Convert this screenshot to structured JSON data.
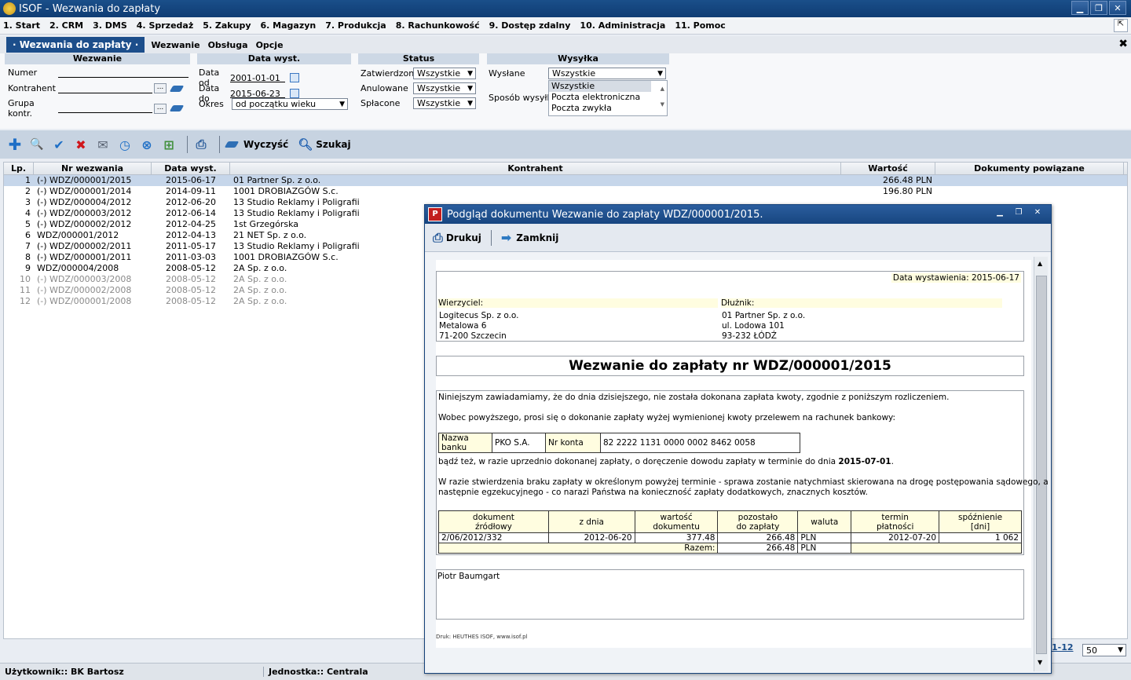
{
  "window": {
    "title": "ISOF - Wezwania do zapłaty",
    "btn_min": "▁",
    "btn_max": "❐",
    "btn_close": "✕"
  },
  "menu": [
    "1. Start",
    "2. CRM",
    "3. DMS",
    "4. Sprzedaż",
    "5. Zakupy",
    "6. Magazyn",
    "7. Produkcja",
    "8. Rachunkowość",
    "9. Dostęp zdalny",
    "10. Administracja",
    "11. Pomoc"
  ],
  "subbar": {
    "active_tab": "· Wezwania do zapłaty ·",
    "items": [
      "Wezwanie",
      "Obsługa",
      "Opcje"
    ]
  },
  "filters": {
    "wezwanie": {
      "header": "Wezwanie",
      "numer": "Numer",
      "kontrahent": "Kontrahent",
      "grupa": "Grupa kontr.",
      "dots": "..."
    },
    "data": {
      "header": "Data wyst.",
      "od_label": "Data od",
      "od_value": "2001-01-01",
      "do_label": "Data do",
      "do_value": "2015-06-23",
      "okres_label": "Okres",
      "okres_value": "od początku wieku"
    },
    "status": {
      "header": "Status",
      "zatw_label": "Zatwierdzone",
      "zatw_value": "Wszystkie",
      "anul_label": "Anulowane",
      "anul_value": "Wszystkie",
      "splac_label": "Spłacone",
      "splac_value": "Wszystkie"
    },
    "wysylka": {
      "header": "Wysyłka",
      "wyslane_label": "Wysłane",
      "wyslane_value": "Wszystkie",
      "sposob_label": "Sposób wysyłki",
      "sposob_options": [
        "Wszystkie",
        "Poczta elektroniczna",
        "Poczta zwykła"
      ]
    }
  },
  "toolbar": {
    "clear": "Wyczyść",
    "search": "Szukaj"
  },
  "grid": {
    "headers": [
      "Lp.",
      "Nr wezwania",
      "Data wyst.",
      "Kontrahent",
      "Wartość",
      "Dokumenty powiązane"
    ],
    "rows": [
      {
        "lp": "1",
        "nr": "(-) WDZ/000001/2015",
        "data": "2015-06-17",
        "kontrahent": "01 Partner Sp. z o.o.",
        "wartosc": "266.48 PLN",
        "dok": ""
      },
      {
        "lp": "2",
        "nr": "(-) WDZ/000001/2014",
        "data": "2014-09-11",
        "kontrahent": "1001 DROBIAZGÓW S.c.",
        "wartosc": "196.80 PLN",
        "dok": ""
      },
      {
        "lp": "3",
        "nr": "(-) WDZ/000004/2012",
        "data": "2012-06-20",
        "kontrahent": "13 Studio Reklamy i Poligrafii",
        "wartosc": "",
        "dok": ""
      },
      {
        "lp": "4",
        "nr": "(-) WDZ/000003/2012",
        "data": "2012-06-14",
        "kontrahent": "13 Studio Reklamy i Poligrafii",
        "wartosc": "",
        "dok": ""
      },
      {
        "lp": "5",
        "nr": "(-) WDZ/000002/2012",
        "data": "2012-04-25",
        "kontrahent": "1st Grzegórska",
        "wartosc": "",
        "dok": ""
      },
      {
        "lp": "6",
        "nr": "WDZ/000001/2012",
        "data": "2012-04-13",
        "kontrahent": "21 NET Sp. z o.o.",
        "wartosc": "",
        "dok": ""
      },
      {
        "lp": "7",
        "nr": "(-) WDZ/000002/2011",
        "data": "2011-05-17",
        "kontrahent": "13 Studio Reklamy i Poligrafii",
        "wartosc": "",
        "dok": ""
      },
      {
        "lp": "8",
        "nr": "(-) WDZ/000001/2011",
        "data": "2011-03-03",
        "kontrahent": "1001 DROBIAZGÓW S.c.",
        "wartosc": "",
        "dok": ""
      },
      {
        "lp": "9",
        "nr": "WDZ/000004/2008",
        "data": "2008-05-12",
        "kontrahent": "2A Sp. z o.o.",
        "wartosc": "",
        "dok": ""
      },
      {
        "lp": "10",
        "nr": "(-) WDZ/000003/2008",
        "data": "2008-05-12",
        "kontrahent": "2A Sp. z o.o.",
        "wartosc": "",
        "dok": ""
      },
      {
        "lp": "11",
        "nr": "(-) WDZ/000002/2008",
        "data": "2008-05-12",
        "kontrahent": "2A Sp. z o.o.",
        "wartosc": "",
        "dok": ""
      },
      {
        "lp": "12",
        "nr": "(-) WDZ/000001/2008",
        "data": "2008-05-12",
        "kontrahent": "2A Sp. z o.o.",
        "wartosc": "",
        "dok": ""
      }
    ]
  },
  "pager": {
    "range": "1-12",
    "page_size": "50"
  },
  "status": {
    "user": "Użytkownik:: BK Bartosz",
    "unit": "Jednostka:: Centrala"
  },
  "modal": {
    "title": "Podgląd dokumentu Wezwanie do zapłaty WDZ/000001/2015.",
    "print": "Drukuj",
    "close": "Zamknij",
    "doc": {
      "date_label": "Data wystawienia:",
      "date_value": "2015-06-17",
      "creditor_label": "Wierzyciel:",
      "creditor": [
        "Logitecus Sp. z o.o.",
        "Metalowa 6",
        "71-200 Szczecin"
      ],
      "debtor_label": "Dłużnik:",
      "debtor": [
        "01 Partner Sp. z o.o.",
        "ul. Lodowa 101",
        "93-232 ŁÓDŹ"
      ],
      "heading": "Wezwanie do zapłaty nr WDZ/000001/2015",
      "p1": "Niniejszym zawiadamiamy, że do dnia dzisiejszego, nie została dokonana zapłata kwoty, zgodnie z poniższym rozliczeniem.",
      "p2": "Wobec powyższego, prosi się o dokonanie zapłaty wyżej wymienionej kwoty przelewem na rachunek bankowy:",
      "bank_label": "Nazwa banku",
      "bank_value": "PKO S.A.",
      "account_label": "Nr konta",
      "account_value": "82 2222 1131 0000 0002 8462 0058",
      "p3_pre": "bądź też, w razie uprzednio dokonanej zapłaty, o doręczenie dowodu zapłaty w terminie do dnia ",
      "p3_date": "2015-07-01",
      "p3_post": ".",
      "p4a": "W razie stwierdzenia braku zapłaty w określonym powyżej terminie - sprawa zostanie natychmiast skierowana na drogę postępowania sądowego, a",
      "p4b": "następnie egzekucyjnego - co narazi Państwa na konieczność zapłaty dodatkowych, znacznych kosztów.",
      "table_headers": [
        "dokument\nźródłowy",
        "z dnia",
        "wartość\ndokumentu",
        "pozostało\ndo zapłaty",
        "waluta",
        "termin\npłatności",
        "spóźnienie\n[dni]"
      ],
      "table_row": [
        "2/06/2012/332",
        "2012-06-20",
        "377.48",
        "266.48",
        "PLN",
        "2012-07-20",
        "1 062"
      ],
      "sum_label": "Razem:",
      "sum_value": "266.48",
      "sum_currency": "PLN",
      "signature": "Piotr Baumgart",
      "footer": "Druk: HEUTHES ISOF, www.isof.pl"
    }
  }
}
